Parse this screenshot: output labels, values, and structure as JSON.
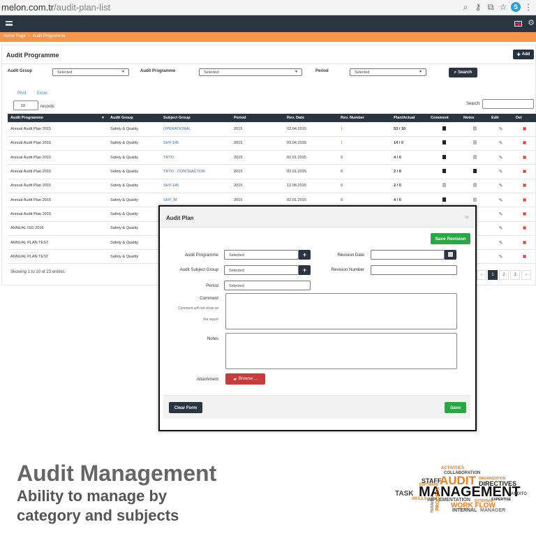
{
  "browser": {
    "url_host": "melon.com.tr",
    "url_path": "/audit-plan-list"
  },
  "breadcrumb": [
    "Home Page",
    "Audit Programme"
  ],
  "page": {
    "title": "Audit Programme",
    "add_label": "Add"
  },
  "filters": {
    "audit_group_label": "Audit Group",
    "audit_group_value": "Selected",
    "audit_programme_label": "Audit Programme",
    "audit_programme_value": "Selected",
    "period_label": "Period",
    "period_value": "Selected",
    "search_label": "Search"
  },
  "toolbar": {
    "print": "Print",
    "excel": "Excel",
    "length_value": "10",
    "records_label": "records",
    "search_label": "Search:"
  },
  "table": {
    "headers": [
      "Audit Programme",
      "Audit Group",
      "Subject Group",
      "Period",
      "Rev. Date",
      "Rev. Number",
      "Plan/Actual",
      "Comment",
      "Notes",
      "Edit",
      "Del"
    ],
    "rows": [
      [
        "Annual Audit Plan 2015",
        "Safety & Quality",
        "OPERATIONAL",
        "2015",
        "03.04.2015",
        "1",
        "53 / 10"
      ],
      [
        "Annual Audit Plan 2015",
        "Safety & Quality",
        "SHY-145",
        "2015",
        "03.04.2015",
        "1",
        "14 / 0"
      ],
      [
        "Annual Audit Plan 2015",
        "Safety & Quality",
        "TRTO",
        "2015",
        "02.01.2015",
        "0",
        "4 / 0"
      ],
      [
        "Annual Audit Plan 2015",
        "Safety & Quality",
        "TRTO - CONTRACTOR",
        "2015",
        "02.01.2015",
        "0",
        "2 / 0"
      ],
      [
        "Annual Audit Plan 2015",
        "Safety & Quality",
        "SHY-145",
        "2015",
        "12.08.2015",
        "0",
        "2 / 0"
      ],
      [
        "Annual Audit Plan 2015",
        "Safety & Quality",
        "SHY_M",
        "2015",
        "02.01.2015",
        "0",
        "4 / 0"
      ],
      [
        "Annual Audit Plan 2015",
        "Safety & Quality",
        "",
        "",
        "",
        "",
        ""
      ],
      [
        "ANNUAL ISG 2016",
        "Safety & Quality",
        "",
        "",
        "",
        "",
        ""
      ],
      [
        "ANNUAL PLAN TEST",
        "Safety & Quality",
        "",
        "",
        "",
        "",
        ""
      ],
      [
        "ANNUAL PLAN TEST",
        "Safety & Quality",
        "",
        "",
        "",
        "",
        ""
      ]
    ],
    "showing": "Showing 1 to 10 of 23 entries",
    "pages": [
      "‹",
      "1",
      "2",
      "3",
      "›"
    ]
  },
  "modal": {
    "title": "Audit Plan",
    "close": "×",
    "save_revision": "Save Revision",
    "audit_programme_label": "Audit Programme",
    "audit_programme_value": "Selected",
    "subject_group_label": "Audit Subject Group",
    "subject_group_value": "Selected",
    "period_label": "Period",
    "period_value": "Selected",
    "revision_date_label": "Revision Date",
    "revision_number_label": "Revision Number",
    "comment_label": "Comment",
    "comment_note_1": "Comment will not show on",
    "comment_note_2": "the report",
    "notes_label": "Notes",
    "attachment_label": "Attachment",
    "browse_label": "Browse ...",
    "clear_label": "Clear Form",
    "save_label": "Save"
  },
  "marketing": {
    "title": "Audit Management",
    "line1": "Ability to manage by",
    "line2": "category and subjects"
  },
  "word_cloud": [
    "ACTIVITIES",
    "COLLABORATION",
    "STAFF",
    "AUDIT",
    "ORGANIZATION",
    "DIRECTIVES",
    "SOFTWARE",
    "TASK",
    "MANAGEMENT",
    "AUDITO",
    "SKILLS",
    "IMPLEMENTATION",
    "EXPERTISE",
    "EXTERNAL",
    "WORK FLOW",
    "TRAINING",
    "PROCESS",
    "INTERNAL",
    "MANAGER"
  ],
  "colors": {
    "dark": "#2a3541",
    "orange": "#f7954a",
    "green": "#28a745",
    "red": "#c73c3c",
    "link": "#2f6db5"
  }
}
